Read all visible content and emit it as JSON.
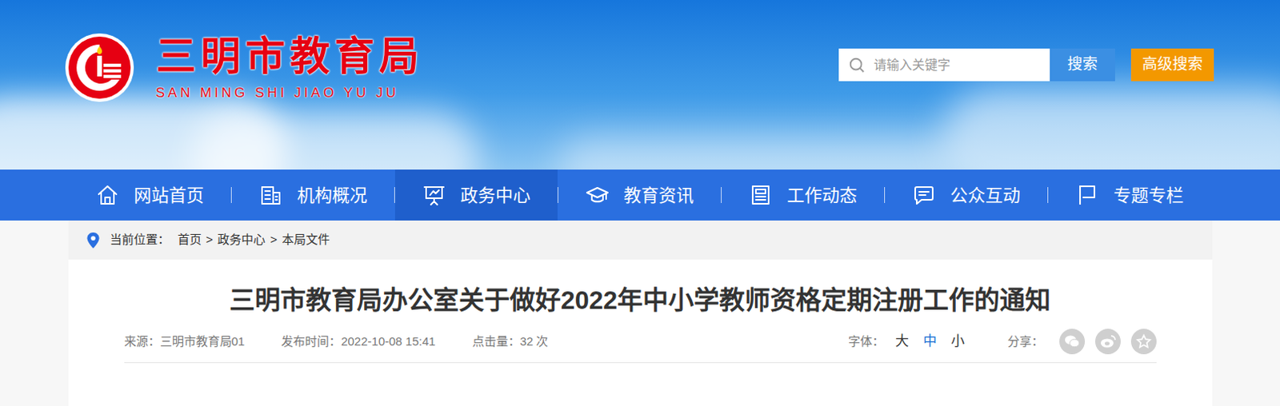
{
  "header": {
    "logo_title": "三明市教育局",
    "logo_subtitle": "SAN MING SHI JIAO YU JU",
    "search": {
      "placeholder": "请输入关键字",
      "button": "搜索",
      "advanced": "高级搜索"
    }
  },
  "nav": [
    {
      "label": "网站首页",
      "selected": false
    },
    {
      "label": "机构概况",
      "selected": false
    },
    {
      "label": "政务中心",
      "selected": true
    },
    {
      "label": "教育资讯",
      "selected": false
    },
    {
      "label": "工作动态",
      "selected": false
    },
    {
      "label": "公众互动",
      "selected": false
    },
    {
      "label": "专题专栏",
      "selected": false
    }
  ],
  "breadcrumb": {
    "label": "当前位置：",
    "separator": ">",
    "items": [
      "首页",
      "政务中心",
      "本局文件"
    ]
  },
  "article": {
    "title": "三明市教育局办公室关于做好2022年中小学教师资格定期注册工作的通知",
    "source": "来源：三明市教育局01",
    "published": "发布时间：2022-10-08 15:41",
    "hits": "点击量：32 次",
    "font_size": {
      "label": "字体：",
      "options": [
        {
          "label": "大",
          "selected": false
        },
        {
          "label": "中",
          "selected": true
        },
        {
          "label": "小",
          "selected": false
        }
      ]
    },
    "share": {
      "label": "分享："
    }
  }
}
